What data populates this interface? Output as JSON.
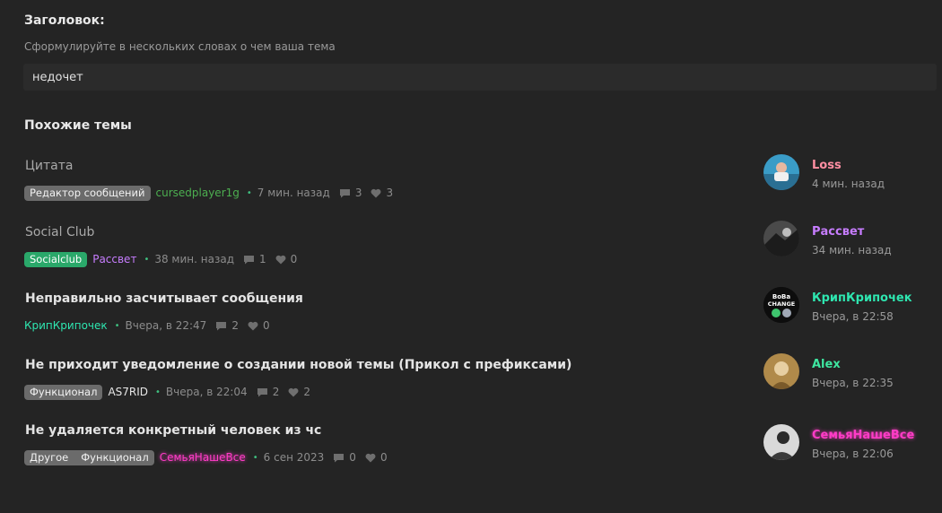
{
  "form": {
    "label": "Заголовок:",
    "hint": "Сформулируйте в нескольких словах о чем ваша тема",
    "value": "недочет"
  },
  "similar": {
    "title": "Похожие темы",
    "threads": [
      {
        "title": "Цитата",
        "prefixes": [
          "Редактор сообщений"
        ],
        "author": "cursedplayer1g",
        "time": "7 мин. назад",
        "replies": "3",
        "likes": "3",
        "last_user": "Loss",
        "last_time": "4 мин. назад"
      },
      {
        "title": "Social Club",
        "prefixes": [
          "Socialclub"
        ],
        "author": "Рассвет",
        "time": "38 мин. назад",
        "replies": "1",
        "likes": "0",
        "last_user": "Рассвет",
        "last_time": "34 мин. назад"
      },
      {
        "title": "Неправильно засчитывает сообщения",
        "prefixes": [],
        "author": "КрипКрипочек",
        "time": "Вчера, в 22:47",
        "replies": "2",
        "likes": "0",
        "last_user": "КрипКрипочек",
        "last_time": "Вчера, в 22:58",
        "avatar_text": [
          "BoBa",
          "CHANGE"
        ]
      },
      {
        "title": "Не приходит уведомление о создании новой темы (Прикол с префиксами)",
        "prefixes": [
          "Функционал"
        ],
        "author": "AS7RID",
        "time": "Вчера, в 22:04",
        "replies": "2",
        "likes": "2",
        "last_user": "Alex",
        "last_time": "Вчера, в 22:35"
      },
      {
        "title": "Не удаляется конкретный человек из чс",
        "prefixes": [
          "Другое",
          "Функционал"
        ],
        "author": "СемьяНашеВсе",
        "time": "6 сен 2023",
        "replies": "0",
        "likes": "0",
        "last_user": "СемьяНашеВсе",
        "last_time": "Вчера, в 22:06"
      }
    ]
  },
  "colors": {
    "background": "#242424",
    "prefix_gray": "#6b6b6b",
    "prefix_green": "#2aa86a",
    "user_green": "#4caf50",
    "user_purple": "#c77dff",
    "user_teal": "#2ee6b0",
    "user_pink": "#ff6b8a",
    "user_magenta": "#ff3cc7"
  },
  "icons": {
    "replies": "comment-icon",
    "likes": "heart-icon",
    "separator": "dot"
  }
}
